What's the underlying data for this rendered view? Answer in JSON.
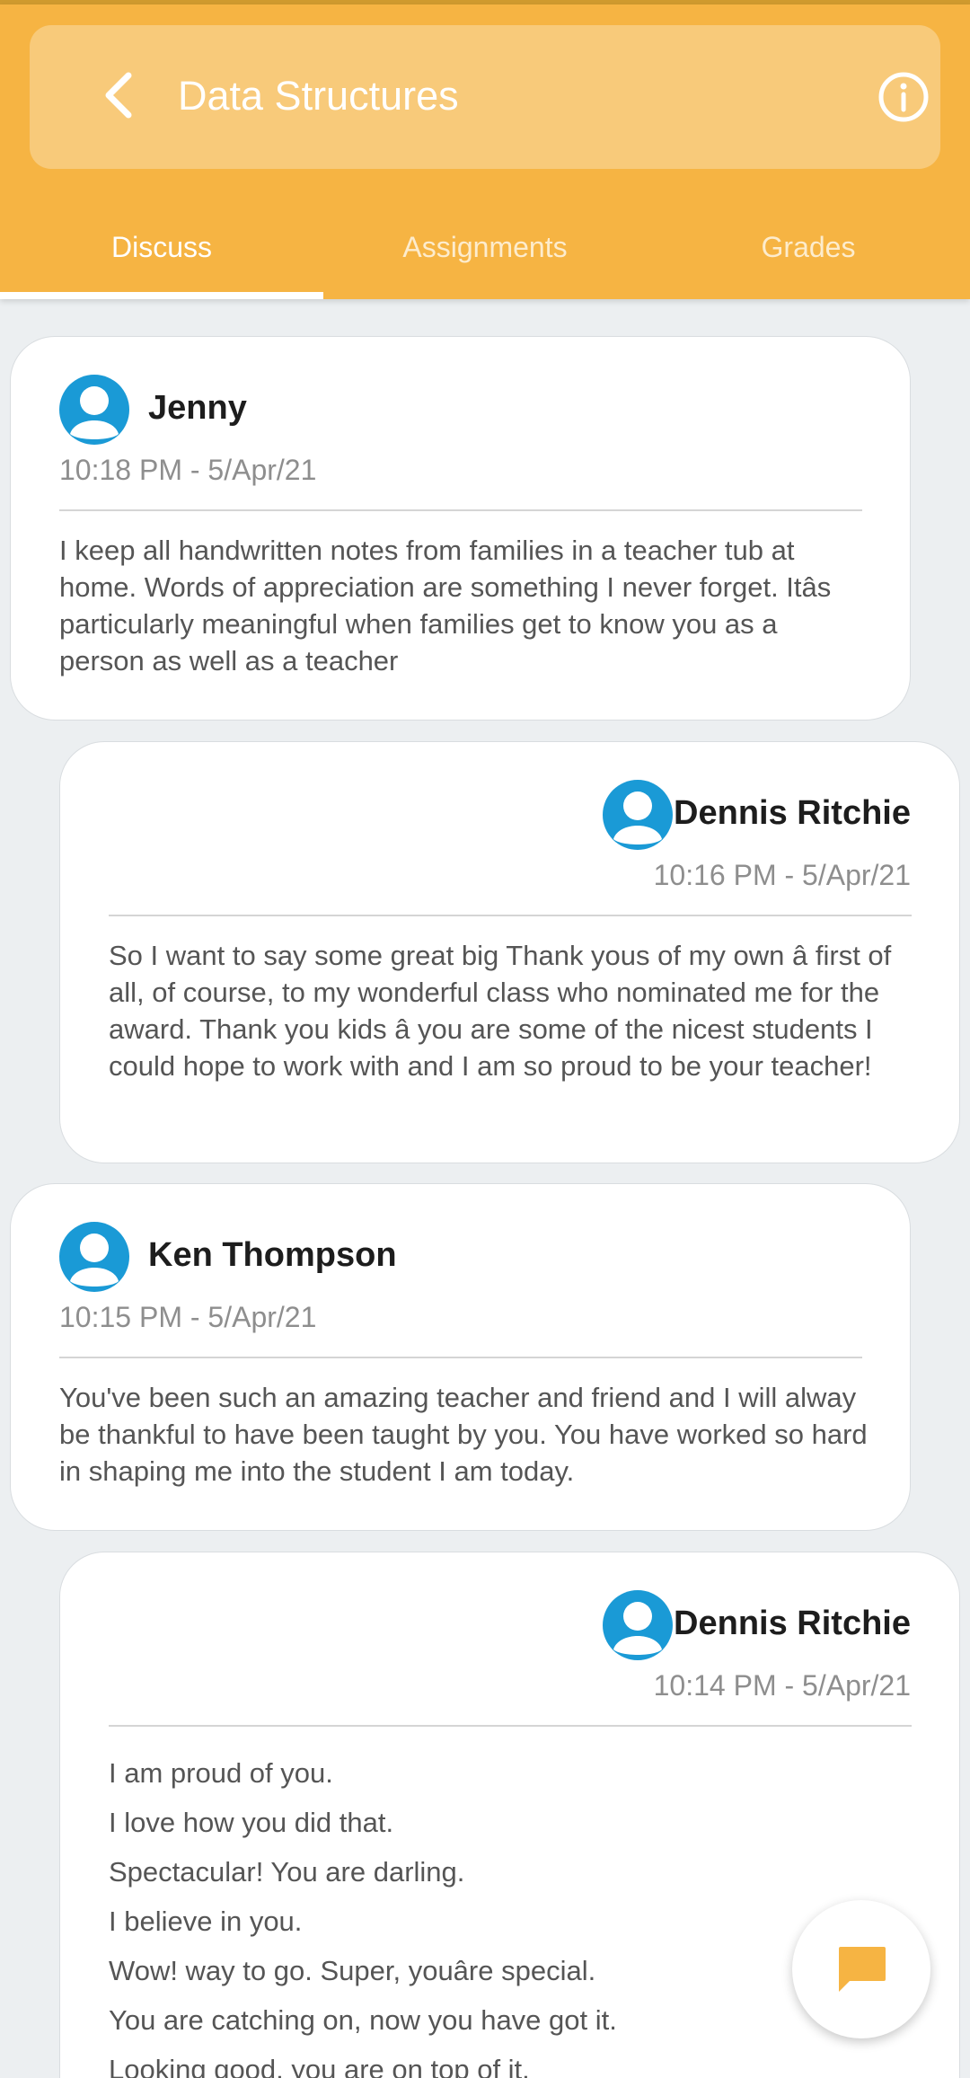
{
  "header": {
    "title": "Data Structures",
    "back_icon": "chevron-left-icon",
    "info_icon": "info-icon"
  },
  "tabs": [
    {
      "label": "Discuss",
      "active": true
    },
    {
      "label": "Assignments",
      "active": false
    },
    {
      "label": "Grades",
      "active": false
    }
  ],
  "posts": [
    {
      "author": "Jenny",
      "time": "10:18 PM - 5/Apr/21",
      "message": "I keep all handwritten notes from families in a teacher tub at home. Words of appreciation are something I never forget. Itâs particularly meaningful when families get to know you as a person as well as a teacher"
    },
    {
      "author": "Dennis Ritchie",
      "time": "10:16 PM - 5/Apr/21",
      "message": "So I want to say some great big Thank yous of my own â first of all, of course, to my wonderful class who nominated me for the award. Thank you kids â you are some of the nicest students I could hope to work with and I am so proud to be your teacher!"
    },
    {
      "author": "Ken Thompson",
      "time": "10:15 PM - 5/Apr/21",
      "message": "You've been such an amazing teacher and friend and I will alway be thankful to have been taught by you. You have worked so hard in shaping me into the student I am today."
    },
    {
      "author": "Dennis Ritchie",
      "time": "10:14 PM - 5/Apr/21",
      "lines": [
        "I am proud of you.",
        "I love how you did that.",
        "Spectacular! You are darling.",
        "I believe in you.",
        "Wow! way to go. Super, youâre special.",
        "You are catching on, now you have got it.",
        "Looking good, you are on top of it."
      ]
    }
  ],
  "fab": {
    "icon": "chat-bubble-icon"
  },
  "colors": {
    "primary": "#f6b443",
    "title_pill": "#f8ca7a",
    "avatar": "#1a9ad6",
    "fab_icon": "#f6b443"
  }
}
